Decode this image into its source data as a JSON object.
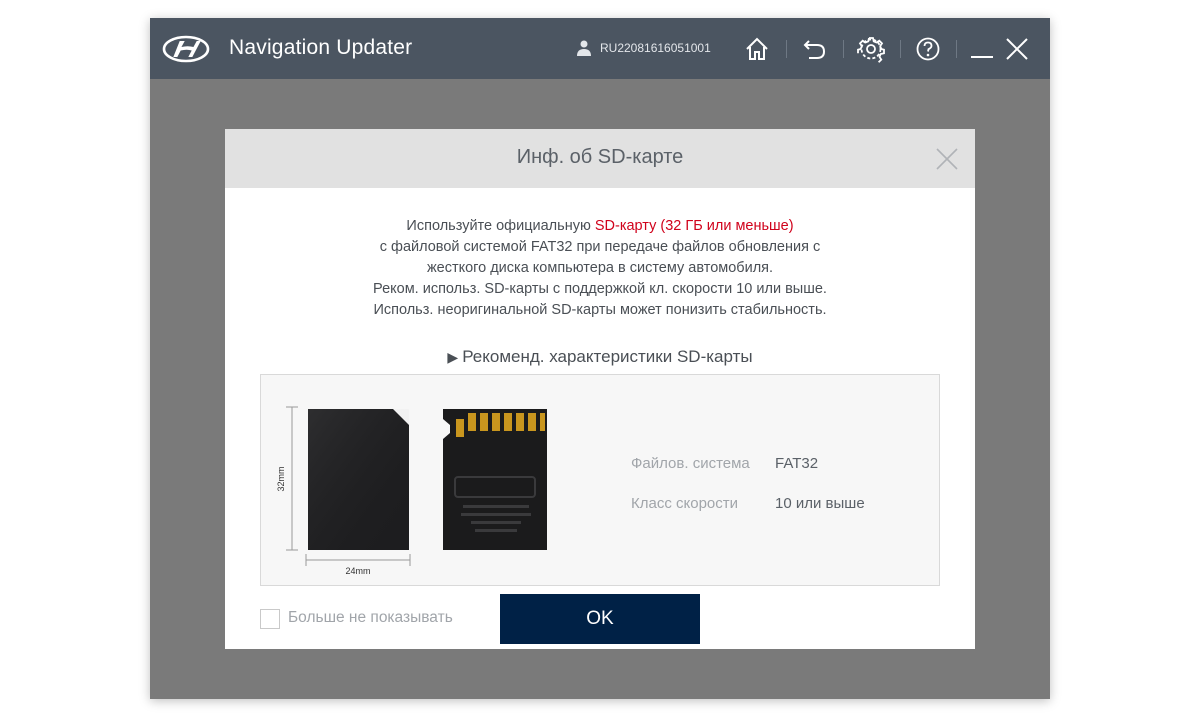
{
  "titlebar": {
    "app_title": "Navigation Updater",
    "user_id": "RU22081616051001",
    "buttons": [
      "home-icon",
      "back-icon",
      "settings-icon",
      "help-icon",
      "minimize-icon",
      "close-icon"
    ]
  },
  "dialog": {
    "title": "Инф. об SD-карте",
    "info_line1_pre": "Используйте официальную ",
    "info_line1_highlight": "SD-карту (32 ГБ или меньше)",
    "info_line2": "с файловой системой FAT32 при передаче файлов обновления с",
    "info_line3": "жесткого диска компьютера в систему автомобиля.",
    "info_line4": "Реком. использ. SD-карты с поддержкой кл. скорости 10 или выше.",
    "info_line5": "Использ. неоригинальной SD-карты может понизить стабильность.",
    "spec_heading": "Рекоменд. характеристики SD-карты",
    "card_height_label": "32mm",
    "card_width_label": "24mm",
    "specs": {
      "filesystem_label": "Файлов. система",
      "filesystem_value": "FAT32",
      "speed_label": "Класс скорости",
      "speed_value": "10 или выше"
    },
    "dont_show_label": "Больше не показывать",
    "ok_label": "OK"
  },
  "colors": {
    "titlebar_bg": "#4b5561",
    "overlay_bg": "#7a7a7a",
    "accent_navy": "#002146",
    "highlight_red": "#d0021b"
  }
}
